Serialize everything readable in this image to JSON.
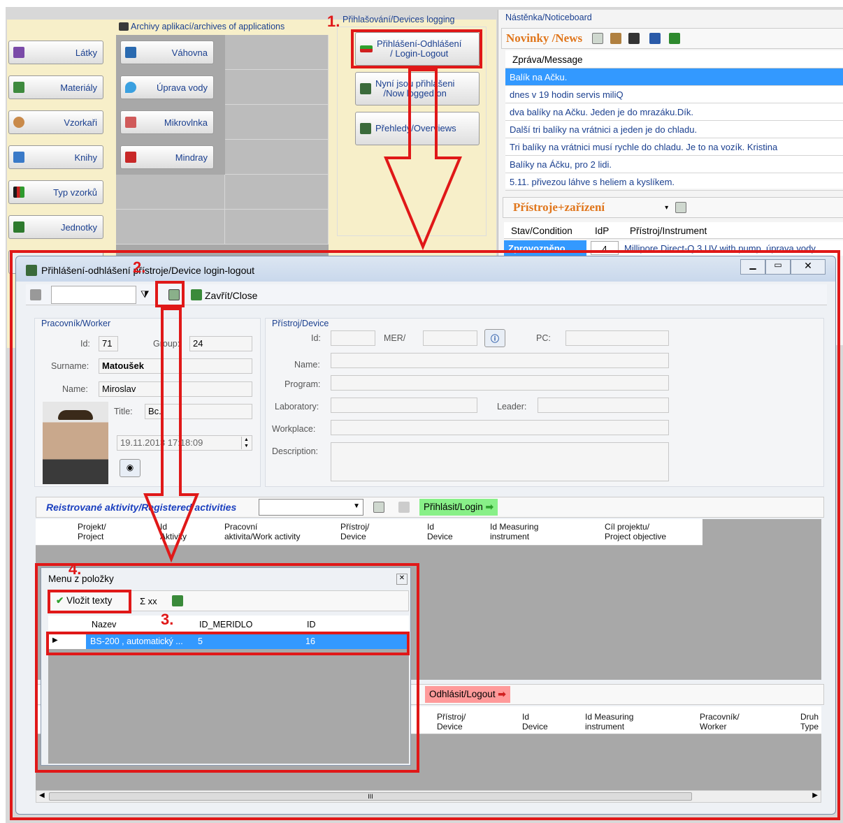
{
  "archives_label": "Archivy aplikací/archives of applications",
  "left_buttons": [
    "Látky",
    "Materiály",
    "Vzorkaři",
    "Knihy",
    "Typ vzorků",
    "Jednotky"
  ],
  "middle_buttons": [
    "Váhovna",
    "Úprava vody",
    "Mikrovlnka",
    "Mindray"
  ],
  "devices_logging": {
    "title": "Přihlašování/Devices logging",
    "login_logout": "Přihlášení-Odhlášení\n/ Login-Logout",
    "logged_on": "Nyní jsou přihlášeni\n/Now logged on",
    "overviews": "Přehledy/Overviews"
  },
  "noticeboard": {
    "title": "Nástěnka/Noticeboard",
    "news_tab": "Novinky /News",
    "column": "Zpráva/Message",
    "rows": [
      "Balík na Ačku.",
      "dnes v 19 hodin servis miliQ",
      "dva balíky na Ačku. Jeden je do mrazáku.Dík.",
      "Další tri balíky na vrátnici a jeden je do chladu.",
      "Tri balíky na vrátnici musí rychle do chladu. Je to na vozík. Kristina",
      "Balíky na Áčku, pro 2 lidi.",
      "5.11. přivezou láhve s heliem a kyslíkem."
    ]
  },
  "instruments": {
    "title": "Přístroje+zařízení",
    "columns": [
      "Stav/Condition",
      "IdP",
      "Přístroj/Instrument"
    ],
    "row_state": "Zprovozněno",
    "row_id": "4",
    "row_name": "Millipore Direct-Q 3 UV with pump, úprava vody"
  },
  "dialog": {
    "title": "Přihlášení-odhlášení přístroje/Device login-logout",
    "close": "Zavřít/Close"
  },
  "worker": {
    "title": "Pracovník/Worker",
    "id_label": "Id:",
    "id": "71",
    "group_label": "Group:",
    "group": "24",
    "surname_label": "Surname:",
    "surname": "Matoušek",
    "name_label": "Name:",
    "name": "Miroslav",
    "title_label": "Title:",
    "title_val": "Bc.",
    "datetime": "19.11.2013   17:18:09"
  },
  "device": {
    "title": "Přístroj/Device",
    "id_label": "Id:",
    "mer_label": "MER/",
    "pc_label": "PC:",
    "name_label": "Name:",
    "program_label": "Program:",
    "lab_label": "Laboratory:",
    "leader_label": "Leader:",
    "workplace_label": "Workplace:",
    "desc_label": "Description:"
  },
  "activities": {
    "title": "Reistrované aktivity/Registered activities",
    "login": "Přihlásit/Login",
    "cols": [
      "Projekt/\nProject",
      "Id\nAktivity",
      "Pracovní\naktivita/Work activity",
      "Přístroj/\nDevice",
      "Id\nDevice",
      "Id Measuring\ninstrument",
      "Cíl projektu/\nProject objective"
    ]
  },
  "logout": {
    "label": "Odhlásit/Logout",
    "cols": [
      "Přístroj/\nDevice",
      "Id\nDevice",
      "Id Measuring\ninstrument",
      "Pracovník/\nWorker",
      "Druh\nType"
    ]
  },
  "popup": {
    "title": "Menu z položky",
    "insert": "Vložit texty",
    "sum": "Σ xx",
    "cols": [
      "Nazev",
      "ID_MERIDLO",
      "ID"
    ],
    "row": [
      "BS-200 , automatický ...",
      "5",
      "16"
    ]
  },
  "steps": [
    "1.",
    "2.",
    "3.",
    "4."
  ],
  "scroll_mark": "III"
}
